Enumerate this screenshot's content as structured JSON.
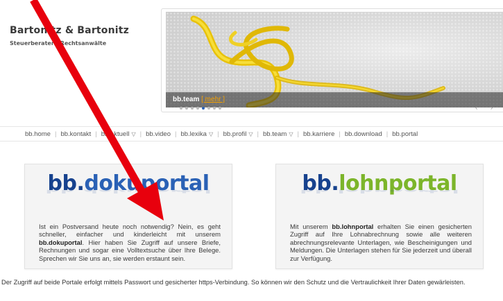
{
  "brand": {
    "name": "Bartonitz & Bartonitz",
    "subtitle": "Steuerberater - Rechtsanwälte"
  },
  "slider": {
    "caption_title": "bb.team",
    "caption_more": "[ mehr ]",
    "dot_count": 8,
    "active_dot": 4,
    "prev_label": "‹",
    "next_label": "›"
  },
  "nav": {
    "items": [
      {
        "label": "bb.home",
        "has_dropdown": false
      },
      {
        "label": "bb.kontakt",
        "has_dropdown": false
      },
      {
        "label": "bb.aktuell",
        "has_dropdown": true
      },
      {
        "label": "bb.video",
        "has_dropdown": false
      },
      {
        "label": "bb.lexika",
        "has_dropdown": true
      },
      {
        "label": "bb.profil",
        "has_dropdown": true
      },
      {
        "label": "bb.team",
        "has_dropdown": true
      },
      {
        "label": "bb.karriere",
        "has_dropdown": false
      },
      {
        "label": "bb.download",
        "has_dropdown": false
      },
      {
        "label": "bb.portal",
        "has_dropdown": false
      }
    ],
    "dropdown_glyph": "▽"
  },
  "cards": {
    "doku": {
      "logo_b": "bb",
      "logo_dot": ".",
      "logo_rest": "dokuportal",
      "text_1": "Ist ein Postversand heute noch notwendig? Nein, es geht schneller, einfacher und kinderleicht mit unserem ",
      "text_bold": "bb.dokuportal",
      "text_2": ". Hier haben Sie Zugriff auf unsere Briefe, Rechnungen und sogar eine Volltextsuche über Ihre Belege. Sprechen wir Sie uns an, sie werden erstaunt sein."
    },
    "lohn": {
      "logo_b": "bb",
      "logo_dot": ".",
      "logo_rest": "lohnportal",
      "text_1": "Mit unserem ",
      "text_bold": "bb.lohnportal",
      "text_2": " erhalten Sie einen gesicherten Zugriff auf Ihre Lohnabrechnung sowie alle weiteren abrechnungsrelevante Unterlagen, wie Bescheinigungen und Meldungen. Die Unterlagen stehen für Sie jederzeit und überall zur Verfügung."
    }
  },
  "footer": {
    "text": "Der Zugriff auf beide Portale erfolgt mittels Passwort und gesicherter https-Verbindung. So können wir den Schutz und die Vertraulichkeit Ihrer Daten gewärleisten."
  },
  "colors": {
    "arrow": "#e8000d",
    "brand_blue": "#17428e",
    "doku_blue": "#2a61b5",
    "lohn_green": "#7cb52a",
    "more_orange": "#f4a000"
  },
  "icons": {
    "dropdown": "triangle-down-icon",
    "annotation": "red-arrow"
  }
}
